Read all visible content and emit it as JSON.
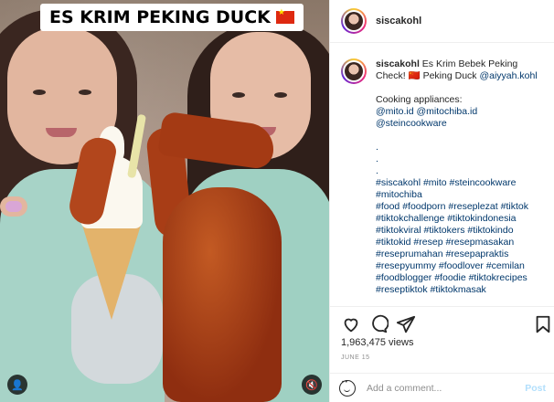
{
  "media": {
    "caption": "ES KRIM PEKING DUCK",
    "flag_icon": "china-flag-icon"
  },
  "header": {
    "username": "siscakohl"
  },
  "post": {
    "username": "siscakohl",
    "text": "Es Krim Bebek Peking Check! 🇨🇳 Peking Duck",
    "mention": "@aiyyah.kohl",
    "line2": "Cooking appliances:",
    "mentions2": "@mito.id @mitochiba.id @steincookware",
    "dots": [
      ".",
      ".",
      "."
    ],
    "hashtags": [
      "#siscakohl #mito #steincookware",
      "#mitochiba",
      "#food #foodporn #reseplezat #tiktok",
      "#tiktokchallenge #tiktokindonesia",
      "#tiktokviral #tiktokers #tiktokindo",
      "#tiktokid #resep #resepmasakan",
      "#reseprumahan #resepapraktis",
      "#resepyummy #foodlover #cemilan",
      "#foodblogger #foodie #tiktokrecipes",
      "#reseptiktok #tiktokmasak"
    ]
  },
  "stats": {
    "views_count": "1,963,475",
    "views_label": "views",
    "date": "JUNE 15"
  },
  "composer": {
    "placeholder": "Add a comment...",
    "post_label": "Post"
  },
  "icons": {
    "like": "heart-icon",
    "comment": "comment-icon",
    "share": "share-icon",
    "save": "bookmark-icon",
    "emoji": "smiley-icon",
    "mute": "mute-icon"
  }
}
